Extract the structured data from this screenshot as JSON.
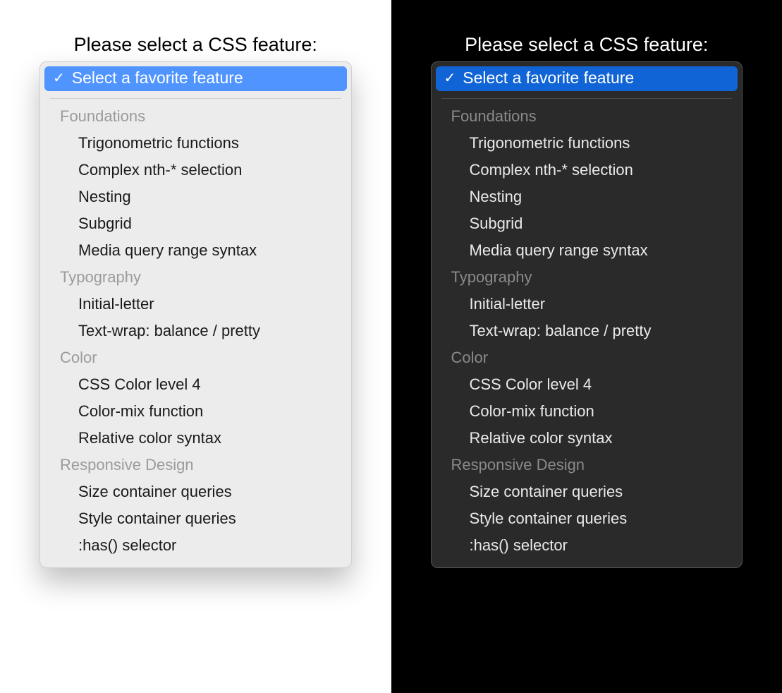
{
  "prompt": "Please select a CSS feature:",
  "selected": "Select a favorite feature",
  "colors": {
    "light_accent": "#4f94ff",
    "dark_accent": "#1064d6"
  },
  "groups": [
    {
      "label": "Foundations",
      "options": [
        "Trigonometric functions",
        "Complex nth-* selection",
        "Nesting",
        "Subgrid",
        "Media query range syntax"
      ]
    },
    {
      "label": "Typography",
      "options": [
        "Initial-letter",
        "Text-wrap: balance / pretty"
      ]
    },
    {
      "label": "Color",
      "options": [
        "CSS Color level 4",
        "Color-mix function",
        "Relative color syntax"
      ]
    },
    {
      "label": "Responsive Design",
      "options": [
        "Size container queries",
        "Style container queries",
        ":has() selector"
      ]
    }
  ]
}
